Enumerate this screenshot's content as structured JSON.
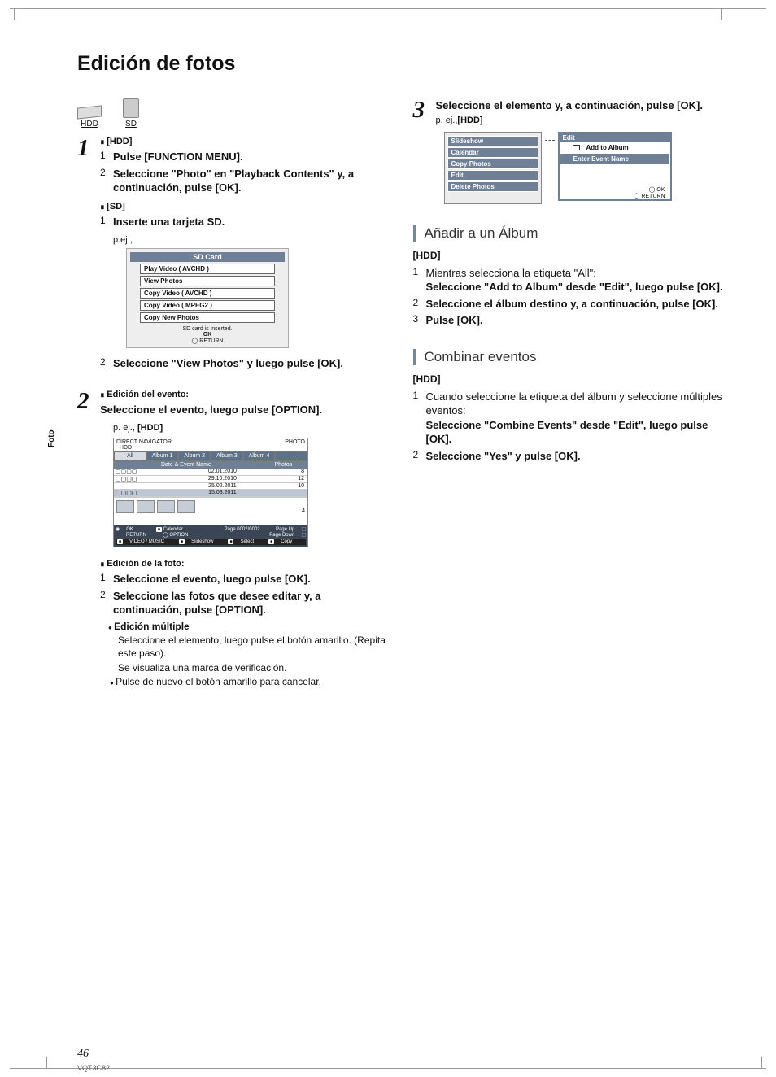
{
  "title": "Edición de fotos",
  "side_tab": "Foto",
  "media": {
    "hdd": "HDD",
    "sd": "SD"
  },
  "step1": {
    "hdd_label": "[HDD]",
    "l1": "Pulse [FUNCTION MENU].",
    "l2": "Seleccione \"Photo\" en \"Playback Contents\" y, a continuación, pulse [OK].",
    "sd_label": "[SD]",
    "l3": "Inserte una tarjeta SD.",
    "eg": "p.ej.,",
    "sd_menu": {
      "title": "SD Card",
      "items": [
        "Play Video ( AVCHD )",
        "View Photos",
        "Copy Video ( AVCHD )",
        "Copy Video ( MPEG2 )",
        "Copy New Photos"
      ],
      "foot": "SD card is inserted.",
      "ok": "OK",
      "return": "RETURN"
    },
    "l4": "Seleccione \"View Photos\" y luego pulse [OK]."
  },
  "step2": {
    "ed_evento": "Edición del evento:",
    "l1": "Seleccione el evento, luego pulse [OPTION].",
    "eg": "p. ej., [HDD]",
    "nav": {
      "title": "DIRECT NAVIGATOR",
      "sub": "HDD",
      "right": "PHOTO",
      "tabs": [
        "All",
        "Album 1",
        "Album 2",
        "Album 3",
        "Album 4",
        "⋯"
      ],
      "col1": "Date & Event Name",
      "col2": "Photos",
      "rows": [
        {
          "thumbs": "",
          "date": "02.01.2010",
          "n": "8"
        },
        {
          "thumbs": "",
          "date": "29.10.2010",
          "n": "12"
        },
        {
          "thumbs": "",
          "date": "25.02.2011",
          "n": "10"
        },
        {
          "thumbs": "",
          "date": "15.03.2011",
          "n": ""
        }
      ],
      "thumb_count": "4",
      "foot_ok": "OK",
      "foot_ret": "RETURN",
      "foot_opt": "OPTION",
      "foot_cal": "Calendar",
      "foot_page": "Page 0002/0002",
      "foot_up": "Page Up",
      "foot_dn": "Page Down",
      "foot_vm": "VIDEO / MUSIC",
      "foot_ss": "Slideshow",
      "foot_sel": "Select",
      "foot_cp": "Copy"
    },
    "ed_foto": "Edición de la foto:",
    "f1": "Seleccione el evento, luego pulse [OK].",
    "f2": "Seleccione las fotos que desee editar y, a continuación, pulse [OPTION].",
    "mult_title": "Edición múltiple",
    "mult1": "Seleccione el elemento, luego pulse el botón amarillo. (Repita este paso).",
    "mult2": "Se visualiza una marca de verificación.",
    "mult3": "Pulse de nuevo el botón amarillo para cancelar."
  },
  "step3": {
    "l1": "Seleccione el elemento y, a continuación, pulse [OK].",
    "eg": "p. ej.,[HDD]",
    "menu_left": [
      "Slideshow",
      "Calendar",
      "Copy Photos",
      "Edit",
      "Delete Photos"
    ],
    "menu_right_title": "Edit",
    "menu_right": [
      "Add to Album",
      "Enter Event Name"
    ],
    "ok": "OK",
    "return": "RETURN"
  },
  "sec_add": {
    "title": "Añadir a un Álbum",
    "tag": "[HDD]",
    "l1a": "Mientras selecciona la etiqueta \"All\":",
    "l1b": "Seleccione \"Add to Album\" desde \"Edit\", luego pulse [OK].",
    "l2": "Seleccione el álbum destino y, a continuación, pulse [OK].",
    "l3": "Pulse [OK]."
  },
  "sec_combine": {
    "title": "Combinar eventos",
    "tag": "[HDD]",
    "l1a": "Cuando seleccione la etiqueta del álbum y seleccione múltiples eventos:",
    "l1b": "Seleccione \"Combine Events\" desde \"Edit\", luego pulse [OK].",
    "l2": "Seleccione \"Yes\" y pulse [OK]."
  },
  "page_num": "46",
  "doc_code": "VQT3C82"
}
